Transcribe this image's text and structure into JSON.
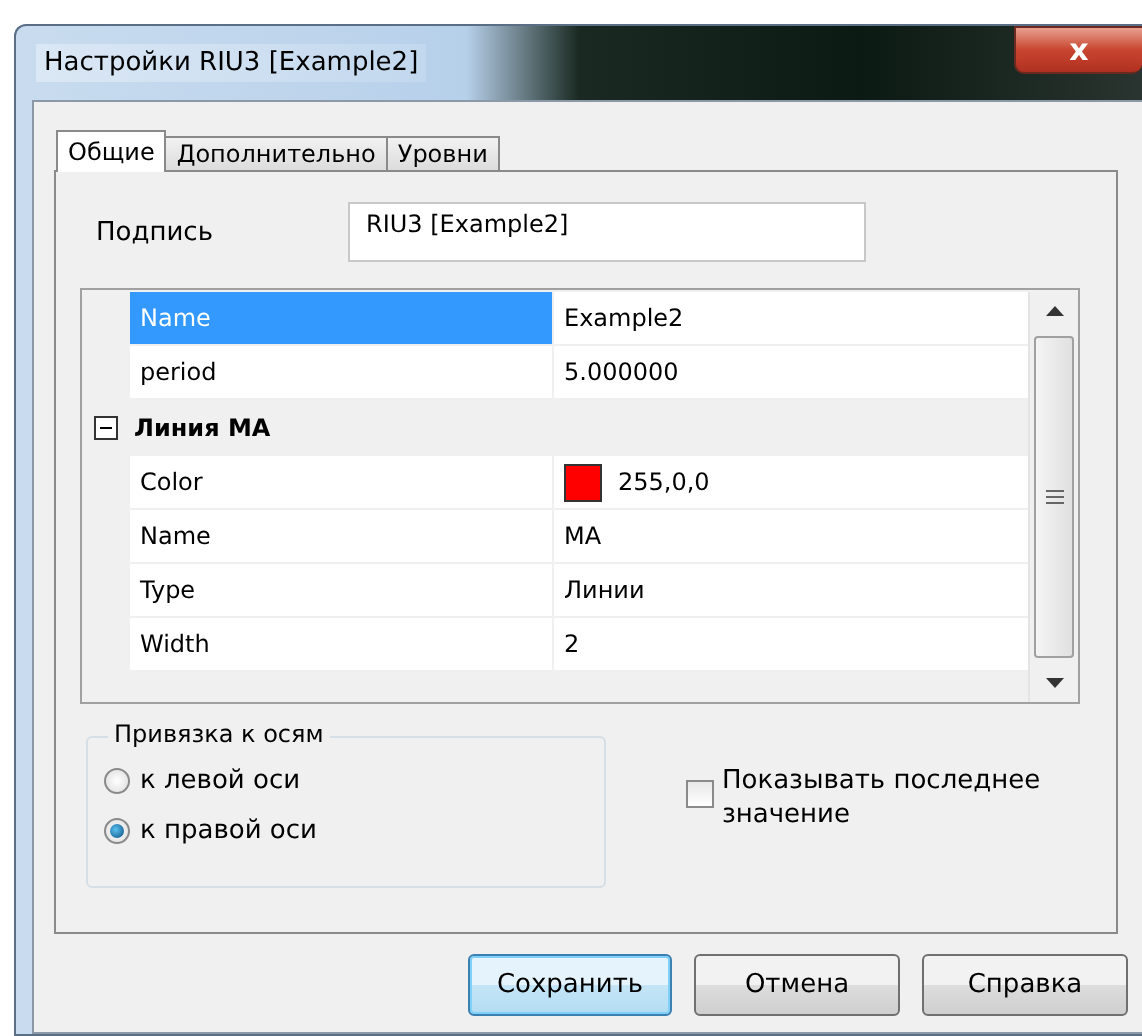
{
  "window": {
    "title": "Настройки RIU3 [Example2]",
    "close": "x"
  },
  "tabs": [
    {
      "label": "Общие",
      "selected": true
    },
    {
      "label": "Дополнительно",
      "selected": false
    },
    {
      "label": "Уровни",
      "selected": false
    }
  ],
  "caption": {
    "label": "Подпись",
    "value": "RIU3 [Example2]"
  },
  "grid": {
    "rows": [
      {
        "kind": "property",
        "name": "Name",
        "value": "Example2",
        "selected": true
      },
      {
        "kind": "property",
        "name": "period",
        "value": "5.000000",
        "selected": false
      },
      {
        "kind": "group",
        "name": "Линия MA",
        "expanded": true
      },
      {
        "kind": "color",
        "name": "Color",
        "value": "255,0,0",
        "color": "#ff0000",
        "selected": false
      },
      {
        "kind": "property",
        "name": "Name",
        "value": "MA",
        "selected": false
      },
      {
        "kind": "property",
        "name": "Type",
        "value": "Линии",
        "selected": false
      },
      {
        "kind": "property",
        "name": "Width",
        "value": "2",
        "selected": false
      }
    ]
  },
  "axis_group": {
    "title": "Привязка к осям",
    "options": [
      {
        "label": "к левой оси",
        "selected": false
      },
      {
        "label": "к правой оси",
        "selected": true
      }
    ]
  },
  "show_last": {
    "label": "Показывать последнее значение",
    "checked": false
  },
  "buttons": [
    {
      "label": "Сохранить",
      "default": true
    },
    {
      "label": "Отмена",
      "default": false
    },
    {
      "label": "Справка",
      "default": false
    }
  ]
}
